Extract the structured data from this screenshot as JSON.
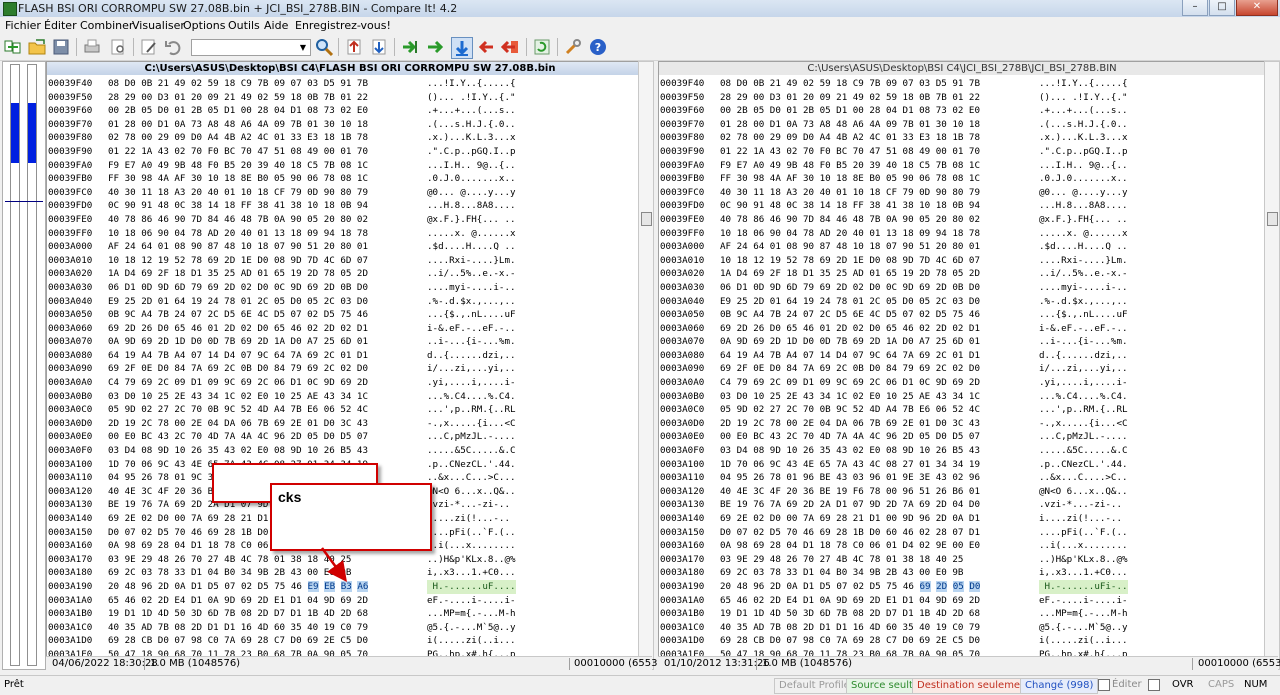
{
  "window": {
    "title": "FLASH BSI ORI CORROMPU SW 27.08B.bin + JCI_BSI_278B.BIN - Compare It! 4.2",
    "controls": [
      "–",
      "□",
      "✕"
    ]
  },
  "menu": {
    "items": [
      "Fichier",
      "Éditer",
      "Combiner",
      "Visualiser",
      "Options",
      "Outils",
      "Aide",
      "Enregistrez-vous!"
    ]
  },
  "toolbar": {
    "icons": [
      "compare-files-icon",
      "open-folder-icon",
      "save-icon",
      "print-icon",
      "print-preview-icon",
      "edit-icon",
      "undo-icon",
      "search-icon",
      "first-diff-icon",
      "prev-diff-icon",
      "next-diff-icon",
      "last-diff-icon",
      "next-change-icon",
      "copy-to-left-icon",
      "copy-to-right-icon",
      "refresh-icon",
      "tools-icon",
      "help-icon"
    ],
    "search_value": ""
  },
  "left": {
    "path": "C:\\Users\\ASUS\\Desktop\\BSI C4\\FLASH BSI ORI CORROMPU SW 27.08B.bin",
    "date": "04/06/2022 18:30:28",
    "size": "1.0 MB (1048576)",
    "position": "00010000 (65536)",
    "lines": [
      {
        "o": "00039F40",
        "h": "08 D0 0B 21 49 02 59 18 C9 7B 09 07 03 D5 91 7B",
        "a": "...!I.Y..{.....{"
      },
      {
        "o": "00039F50",
        "h": "28 29 00 D3 01 20 09 21 49 02 59 18 0B 7B 01 22",
        "a": "()... .!I.Y..{.\""
      },
      {
        "o": "00039F60",
        "h": "00 2B 05 D0 01 2B 05 D1 00 28 04 D1 08 73 02 E0",
        "a": ".+...+...(...s.."
      },
      {
        "o": "00039F70",
        "h": "01 28 00 D1 0A 73 A8 48 A6 4A 09 7B 01 30 10 18",
        "a": ".(...s.H.J.{.0.."
      },
      {
        "o": "00039F80",
        "h": "02 78 00 29 09 D0 A4 4B A2 4C 01 33 E3 18 1B 78",
        "a": ".x.)...K.L.3...x"
      },
      {
        "o": "00039F90",
        "h": "01 22 1A 43 02 70 F0 BC 70 47 51 08 49 00 01 70",
        "a": ".\".C.p..pGQ.I..p"
      },
      {
        "o": "00039FA0",
        "h": "F9 E7 A0 49 9B 48 F0 B5 20 39 40 18 C5 7B 08 1C",
        "a": "...I.H.. 9@..{.."
      },
      {
        "o": "00039FB0",
        "h": "FF 30 98 4A AF 30 10 18 8E B0 05 90 06 78 08 1C",
        "a": ".0.J.0.......x.."
      },
      {
        "o": "00039FC0",
        "h": "40 30 11 18 A3 20 40 01 10 18 CF 79 0D 90 80 79",
        "a": "@0... @....y...y"
      },
      {
        "o": "00039FD0",
        "h": "0C 90 91 48 0C 38 14 18 FF 38 41 38 10 18 0B 94",
        "a": "...H.8...8A8...."
      },
      {
        "o": "00039FE0",
        "h": "40 78 86 46 90 7D 84 46 48 7B 0A 90 05 20 80 02",
        "a": "@x.F.}.FH{... .."
      },
      {
        "o": "00039FF0",
        "h": "10 18 06 90 04 78 AD 20 40 01 13 18 09 94 18 78",
        "a": ".....x. @......x"
      },
      {
        "o": "0003A000",
        "h": "AF 24 64 01 08 90 87 48 10 18 07 90 51 20 80 01",
        "a": ".$d....H....Q .."
      },
      {
        "o": "0003A010",
        "h": "10 18 12 19 52 78 69 2D 1E D0 08 9D 7D 4C 6D 07",
        "a": "....Rxi-....}Lm."
      },
      {
        "o": "0003A020",
        "h": "1A D4 69 2F 18 D1 35 25 AD 01 65 19 2D 78 05 2D",
        "a": "..i/..5%..e.-x.-"
      },
      {
        "o": "0003A030",
        "h": "06 D1 0D 9D 6D 79 69 2D 02 D0 0C 9D 69 2D 0B D0",
        "a": "....myi-....i-.."
      },
      {
        "o": "0003A040",
        "h": "E9 25 2D 01 64 19 24 78 01 2C 05 D0 05 2C 03 D0",
        "a": ".%-.d.$x.,...,.."
      },
      {
        "o": "0003A050",
        "h": "0B 9C A4 7B 24 07 2C D5 6E 4C D5 07 02 D5 75 46",
        "a": "...{$.,.nL....uF"
      },
      {
        "o": "0003A060",
        "h": "69 2D 26 D0 65 46 01 2D 02 D0 65 46 02 2D 02 D1",
        "a": "i-&.eF.-..eF.-.."
      },
      {
        "o": "0003A070",
        "h": "0A 9D 69 2D 1D D0 0D 7B 69 2D 1A D0 A7 25 6D 01",
        "a": "..i-...{i-...%m."
      },
      {
        "o": "0003A080",
        "h": "64 19 A4 7B A4 07 14 D4 07 9C 64 7A 69 2C 01 D1",
        "a": "d..{......dzi,.."
      },
      {
        "o": "0003A090",
        "h": "69 2F 0E D0 84 7A 69 2C 0B D0 84 79 69 2C 02 D0",
        "a": "i/...zi,...yi,.."
      },
      {
        "o": "0003A0A0",
        "h": "C4 79 69 2C 09 D1 09 9C 69 2C 06 D1 0C 9D 69 2D",
        "a": ".yi,....i,....i-"
      },
      {
        "o": "0003A0B0",
        "h": "03 D0 10 25 2E 43 34 1C 02 E0 10 25 AE 43 34 1C",
        "a": "...%.C4....%.C4."
      },
      {
        "o": "0003A0C0",
        "h": "05 9D 02 27 2C 70 0B 9C 52 4D A4 7B E6 06 52 4C",
        "a": "...',p..RM.{..RL"
      },
      {
        "o": "0003A0D0",
        "h": "2D 19 2C 78 00 2E 04 DA 06 7B 69 2E 01 D0 3C 43",
        "a": "-.,x.....{i...<C"
      },
      {
        "o": "0003A0E0",
        "h": "00 E0 BC 43 2C 70 4D 7A 4A 4C 96 2D 05 D0 D5 07",
        "a": "...C,pMzJL.-...."
      },
      {
        "o": "0003A0F0",
        "h": "03 D4 08 9D 10 26 35 43 02 E0 08 9D 10 26 B5 43",
        "a": ".....&5C.....&.C"
      },
      {
        "o": "0003A100",
        "h": "1D 70 06 9C 43 4E 65 7A 43 4C 08 27 01 34 34 19",
        "a": ".p..CNezCL.'.44."
      },
      {
        "o": "0003A110",
        "h": "04 95 26 78 01 9C 3E 43 26 70 05 96 01 3E 43 96",
        "a": "..&x...C...>C..."
      },
      {
        "o": "0003A120",
        "h": "40 4E 3C 4F 20 36 BE 19 F6 78 00 96 51 26 B6 01",
        "a": "@N<O 6...x..Q&.."
      },
      {
        "o": "0003A130",
        "h": "BE 19 76 7A 69 2D 2A D1 07 9D 2D 7A 69 2D 04 D0",
        "a": ".vzi-*...-zi-.."
      },
      {
        "o": "0003A140",
        "h": "69 2E 02 D0 00 7A 69 28 21 D1 00 9D 96 2D 0A D1",
        "a": "i....zi(!...-.."
      },
      {
        "o": "0003A150",
        "h": "D0 07 02 D5 70 46 69 28 1B D0 60 46 02 28 07 D1",
        "a": "....pFi(..`F.(.."
      },
      {
        "o": "0003A160",
        "h": "0A 98 69 28 04 D1 18 78 C0 06 01 D4 02 9E 00 E0",
        "a": "..i(...x........"
      },
      {
        "o": "0003A170",
        "h": "03 9E 29 48 26 70 27 4B 4C 78 01 38 18 40 25",
        "a": "..)H&p'KLx.8..@%"
      },
      {
        "o": "0003A180",
        "h": "69 2C 03 78 33 D1 04 B0 34 9B 2B 43 00 E0 9B",
        "a": "i,.x3...1.+C0..."
      },
      {
        "o": "0003A190",
        "h": "20 48 96 2D 0A D1 D5 07 02 D5 75 46 E9 EB B3 A6",
        "a": " H.-......uF....",
        "hl": [
          12,
          13,
          14,
          15
        ]
      },
      {
        "o": "0003A1A0",
        "h": "65 46 02 2D E4 D1 0A 9D 69 2D E1 D1 04 9D 69 2D",
        "a": "eF.-....i-....i-"
      },
      {
        "o": "0003A1B0",
        "h": "19 D1 1D 4D 50 3D 6D 7B 08 2D D7 D1 1B 4D 2D 68",
        "a": "...MP=m{.-...M-h"
      },
      {
        "o": "0003A1C0",
        "h": "40 35 AD 7B 08 2D D1 D1 16 4D 60 35 40 19 C0 79",
        "a": "@5.{.-...M`5@..y"
      },
      {
        "o": "0003A1D0",
        "h": "69 28 CB D0 07 98 C0 7A 69 28 C7 D0 69 2E C5 D0",
        "a": "i(.....zi(..i..."
      },
      {
        "o": "0003A1E0",
        "h": "50 47 18 90 68 70 11 78 23 B0 68 7B 0A 90 05 70",
        "a": "PG..hp.x#.h{...p"
      }
    ]
  },
  "right": {
    "path": "C:\\Users\\ASUS\\Desktop\\BSI C4\\JCI_BSI_278B\\JCI_BSI_278B.BIN",
    "date": "01/10/2012 13:31:26",
    "size": "1.0 MB (1048576)",
    "position": "00010000 (65536)",
    "lines": [
      {
        "o": "00039F40",
        "h": "08 D0 0B 21 49 02 59 18 C9 7B 09 07 03 D5 91 7B",
        "a": "...!I.Y..{.....{"
      },
      {
        "o": "00039F50",
        "h": "28 29 00 D3 01 20 09 21 49 02 59 18 0B 7B 01 22",
        "a": "()... .!I.Y..{.\""
      },
      {
        "o": "00039F60",
        "h": "00 2B 05 D0 01 2B 05 D1 00 28 04 D1 08 73 02 E0",
        "a": ".+...+...(...s.."
      },
      {
        "o": "00039F70",
        "h": "01 28 00 D1 0A 73 A8 48 A6 4A 09 7B 01 30 10 18",
        "a": ".(...s.H.J.{.0.."
      },
      {
        "o": "00039F80",
        "h": "02 78 00 29 09 D0 A4 4B A2 4C 01 33 E3 18 1B 78",
        "a": ".x.)...K.L.3...x"
      },
      {
        "o": "00039F90",
        "h": "01 22 1A 43 02 70 F0 BC 70 47 51 08 49 00 01 70",
        "a": ".\".C.p..pGQ.I..p"
      },
      {
        "o": "00039FA0",
        "h": "F9 E7 A0 49 9B 48 F0 B5 20 39 40 18 C5 7B 08 1C",
        "a": "...I.H.. 9@..{.."
      },
      {
        "o": "00039FB0",
        "h": "FF 30 98 4A AF 30 10 18 8E B0 05 90 06 78 08 1C",
        "a": ".0.J.0.......x.."
      },
      {
        "o": "00039FC0",
        "h": "40 30 11 18 A3 20 40 01 10 18 CF 79 0D 90 80 79",
        "a": "@0... @....y...y"
      },
      {
        "o": "00039FD0",
        "h": "0C 90 91 48 0C 38 14 18 FF 38 41 38 10 18 0B 94",
        "a": "...H.8...8A8...."
      },
      {
        "o": "00039FE0",
        "h": "40 78 86 46 90 7D 84 46 48 7B 0A 90 05 20 80 02",
        "a": "@x.F.}.FH{... .."
      },
      {
        "o": "00039FF0",
        "h": "10 18 06 90 04 78 AD 20 40 01 13 18 09 94 18 78",
        "a": ".....x. @......x"
      },
      {
        "o": "0003A000",
        "h": "AF 24 64 01 08 90 87 48 10 18 07 90 51 20 80 01",
        "a": ".$d....H....Q .."
      },
      {
        "o": "0003A010",
        "h": "10 18 12 19 52 78 69 2D 1E D0 08 9D 7D 4C 6D 07",
        "a": "....Rxi-....}Lm."
      },
      {
        "o": "0003A020",
        "h": "1A D4 69 2F 18 D1 35 25 AD 01 65 19 2D 78 05 2D",
        "a": "..i/..5%..e.-x.-"
      },
      {
        "o": "0003A030",
        "h": "06 D1 0D 9D 6D 79 69 2D 02 D0 0C 9D 69 2D 0B D0",
        "a": "....myi-....i-.."
      },
      {
        "o": "0003A040",
        "h": "E9 25 2D 01 64 19 24 78 01 2C 05 D0 05 2C 03 D0",
        "a": ".%-.d.$x.,...,.."
      },
      {
        "o": "0003A050",
        "h": "0B 9C A4 7B 24 07 2C D5 6E 4C D5 07 02 D5 75 46",
        "a": "...{$.,.nL....uF"
      },
      {
        "o": "0003A060",
        "h": "69 2D 26 D0 65 46 01 2D 02 D0 65 46 02 2D 02 D1",
        "a": "i-&.eF.-..eF.-.."
      },
      {
        "o": "0003A070",
        "h": "0A 9D 69 2D 1D D0 0D 7B 69 2D 1A D0 A7 25 6D 01",
        "a": "..i-...{i-...%m."
      },
      {
        "o": "0003A080",
        "h": "64 19 A4 7B A4 07 14 D4 07 9C 64 7A 69 2C 01 D1",
        "a": "d..{......dzi,.."
      },
      {
        "o": "0003A090",
        "h": "69 2F 0E D0 84 7A 69 2C 0B D0 84 79 69 2C 02 D0",
        "a": "i/...zi,...yi,.."
      },
      {
        "o": "0003A0A0",
        "h": "C4 79 69 2C 09 D1 09 9C 69 2C 06 D1 0C 9D 69 2D",
        "a": ".yi,....i,....i-"
      },
      {
        "o": "0003A0B0",
        "h": "03 D0 10 25 2E 43 34 1C 02 E0 10 25 AE 43 34 1C",
        "a": "...%.C4....%.C4."
      },
      {
        "o": "0003A0C0",
        "h": "05 9D 02 27 2C 70 0B 9C 52 4D A4 7B E6 06 52 4C",
        "a": "...',p..RM.{..RL"
      },
      {
        "o": "0003A0D0",
        "h": "2D 19 2C 78 00 2E 04 DA 06 7B 69 2E 01 D0 3C 43",
        "a": "-.,x.....{i...<C"
      },
      {
        "o": "0003A0E0",
        "h": "00 E0 BC 43 2C 70 4D 7A 4A 4C 96 2D 05 D0 D5 07",
        "a": "...C,pMzJL.-...."
      },
      {
        "o": "0003A0F0",
        "h": "03 D4 08 9D 10 26 35 43 02 E0 08 9D 10 26 B5 43",
        "a": ".....&5C.....&.C"
      },
      {
        "o": "0003A100",
        "h": "1D 70 06 9C 43 4E 65 7A 43 4C 08 27 01 34 34 19",
        "a": ".p..CNezCL.'.44."
      },
      {
        "o": "0003A110",
        "h": "04 95 26 78 01 96 BE 43 03 96 01 9E 3E 43 02 96",
        "a": "..&x...C....>C.."
      },
      {
        "o": "0003A120",
        "h": "40 4E 3C 4F 20 36 BE 19 F6 78 00 96 51 26 B6 01",
        "a": "@N<O 6...x..Q&.."
      },
      {
        "o": "0003A130",
        "h": "BE 19 76 7A 69 2D 2A D1 07 9D 2D 7A 69 2D 04 D0",
        "a": ".vzi-*...-zi-.."
      },
      {
        "o": "0003A140",
        "h": "69 2E 02 D0 00 7A 69 28 21 D1 00 9D 96 2D 0A D1",
        "a": "i....zi(!...-.."
      },
      {
        "o": "0003A150",
        "h": "D0 07 02 D5 70 46 69 28 1B D0 60 46 02 28 07 D1",
        "a": "....pFi(..`F.(.."
      },
      {
        "o": "0003A160",
        "h": "0A 98 69 28 04 D1 18 78 C0 06 01 D4 02 9E 00 E0",
        "a": "..i(...x........"
      },
      {
        "o": "0003A170",
        "h": "03 9E 29 48 26 70 27 4B 4C 78 01 38 18 40 25",
        "a": "..)H&p'KLx.8..@%"
      },
      {
        "o": "0003A180",
        "h": "69 2C 03 78 33 D1 04 B0 34 9B 2B 43 00 E0 9B",
        "a": "i,.x3...1.+C0..."
      },
      {
        "o": "0003A190",
        "h": "20 48 96 2D 0A D1 D5 07 02 D5 75 46 69 2D 05 D0",
        "a": " H.-......uFi-..",
        "hl": [
          12,
          13,
          14,
          15
        ]
      },
      {
        "o": "0003A1A0",
        "h": "65 46 02 2D E4 D1 0A 9D 69 2D E1 D1 04 9D 69 2D",
        "a": "eF.-....i-....i-"
      },
      {
        "o": "0003A1B0",
        "h": "19 D1 1D 4D 50 3D 6D 7B 08 2D D7 D1 1B 4D 2D 68",
        "a": "...MP=m{.-...M-h"
      },
      {
        "o": "0003A1C0",
        "h": "40 35 AD 7B 08 2D D1 D1 16 4D 60 35 40 19 C0 79",
        "a": "@5.{.-...M`5@..y"
      },
      {
        "o": "0003A1D0",
        "h": "69 28 CB D0 07 98 C0 7A 69 28 C7 D0 69 2E C5 D0",
        "a": "i(.....zi(..i..."
      },
      {
        "o": "0003A1E0",
        "h": "50 47 18 90 68 70 11 78 23 B0 68 7B 0A 90 05 70",
        "a": "PG..hp.x#.h{...p"
      }
    ]
  },
  "annotation": {
    "label": "cks"
  },
  "status": {
    "ready": "Prêt",
    "default_profile": "Default Profile",
    "source_only": "Source seult.",
    "dest_only": "Destination seulement",
    "changed": "Changé (998)",
    "edit": "Éditer",
    "ovr": "OVR",
    "caps": "CAPS",
    "num": "NUM"
  },
  "colors": {
    "source_only": "#2e8b2e",
    "dest_only": "#c03020",
    "changed": "#2050c0",
    "highlight": "#b8d4f0"
  }
}
